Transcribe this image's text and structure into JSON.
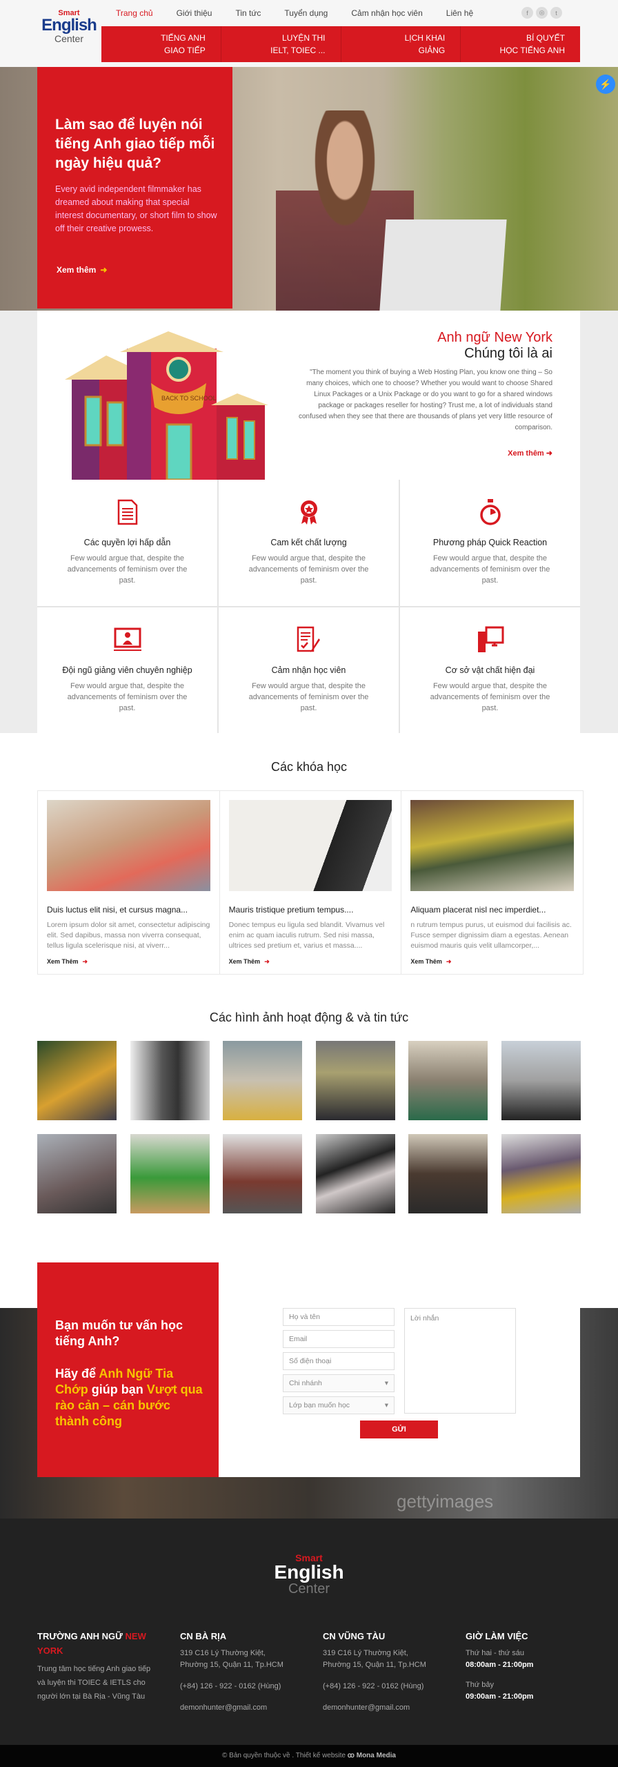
{
  "brand": {
    "logo_smart": "Smart",
    "logo_english": "English",
    "logo_center": "Center"
  },
  "top_nav": [
    {
      "label": "Trang chủ",
      "active": true
    },
    {
      "label": "Giới thiệu"
    },
    {
      "label": "Tin tức"
    },
    {
      "label": "Tuyển dụng"
    },
    {
      "label": "Cảm nhận học viên"
    },
    {
      "label": "Liên hệ"
    }
  ],
  "social": [
    "facebook-icon",
    "instagram-icon",
    "twitter-icon"
  ],
  "main_menu": [
    "Tiếng Anh\nGiao tiếp",
    "Luyện thi\nIELT, TOIEC ...",
    "Lịch khai\ngiảng",
    "Bí quyết\nhọc tiếng Anh"
  ],
  "hero": {
    "title": "Làm sao để luyện nói tiếng Anh giao tiếp mỗi ngày hiệu quả?",
    "body": "Every avid independent filmmaker has dreamed about making that special interest documentary, or short film to show off their creative prowess.",
    "more": "Xem thêm"
  },
  "about": {
    "title_red": "Anh ngữ New York",
    "title": "Chúng tôi là ai",
    "body": "\"The moment you think of buying a Web Hosting Plan, you know one thing – So many choices, which one to choose? Whether you would want to choose Shared Linux Packages or a Unix Package or do you want to go for a shared windows package or packages reseller for hosting? Trust me, a lot of individuals stand confused when they see that there are thousands of plans yet very little resource of comparison.",
    "more": "Xem thêm",
    "banner": "BACK TO SCHOOL"
  },
  "features": [
    {
      "icon": "document-icon",
      "title": "Các quyền lợi hấp dẫn",
      "text": "Few would argue that, despite the advancements of feminism over the past."
    },
    {
      "icon": "award-ribbon-icon",
      "title": "Cam kết chất lượng",
      "text": "Few would argue that, despite the advancements of feminism over the past."
    },
    {
      "icon": "stopwatch-icon",
      "title": "Phương pháp Quick Reaction",
      "text": "Few would argue that, despite the advancements of feminism over the past."
    },
    {
      "icon": "teacher-screen-icon",
      "title": "Đội ngũ giảng viên chuyên nghiệp",
      "text": "Few would argue that, despite the advancements of feminism over the past."
    },
    {
      "icon": "feedback-form-icon",
      "title": "Cảm nhận học viên",
      "text": "Few would argue that, despite the advancements of feminism over the past."
    },
    {
      "icon": "desktop-computer-icon",
      "title": "Cơ sở vật chất hiện đại",
      "text": "Few would argue that, despite the advancements of feminism over the past."
    }
  ],
  "courses": {
    "title": "Các khóa học",
    "items": [
      {
        "title": "Duis luctus elit nisi, et cursus magna...",
        "text": "Lorem ipsum dolor sit amet, consectetur adipiscing elit. Sed dapibus, massa non viverra consequat, tellus ligula scelerisque nisi, at viverr...",
        "more": "Xem Thêm"
      },
      {
        "title": "Mauris tristique pretium tempus....",
        "text": "Donec tempus eu ligula sed blandit. Vivamus vel enim ac quam iaculis rutrum. Sed nisi massa, ultrices sed pretium et, varius et massa....",
        "more": "Xem Thêm"
      },
      {
        "title": "Aliquam placerat nisl nec imperdiet...",
        "text": "n rutrum tempus purus, ut euismod dui facilisis ac. Fusce semper dignissim diam a egestas. Aenean euismod mauris quis velit ullamcorper,...",
        "more": "Xem Thêm"
      }
    ]
  },
  "gallery": {
    "title": "Các hình ảnh hoạt động & và tin tức"
  },
  "contact": {
    "heading1": "Bạn muốn tư vấn học tiếng Anh?",
    "h2_a": "Hãy để ",
    "h2_b": "Anh Ngữ Tia Chớp",
    "h2_c": " giúp bạn ",
    "h2_d": "Vượt qua rào cản – cán bước thành công",
    "name_ph": "Họ và tên",
    "email_ph": "Email",
    "phone_ph": "Số điện thoại",
    "branch": "Chi nhánh",
    "class": "Lớp bạn muốn học",
    "message_ph": "Lời nhắn",
    "submit": "GỬI",
    "watermark": "gettyimages"
  },
  "footer": {
    "col1_title": "TRƯỜNG ANH NGỮ ",
    "col1_title_red": "NEW YORK",
    "col1_text": "Trung tâm học tiếng Anh giao tiếp và luyện thi TOIEC & IETLS cho người lớn tại Bà Rịa - Vũng Tàu",
    "col2_title": "CN BÀ RỊA",
    "col2_addr": "319 C16 Lý Thường Kiệt, Phường 15, Quận 11, Tp.HCM",
    "col2_phone": "(+84) 126 - 922 - 0162 (Hùng)",
    "col2_email": "demonhunter@gmail.com",
    "col3_title": "CN VŨNG TÀU",
    "col3_addr": "319 C16 Lý Thường Kiệt, Phường 15, Quận 11, Tp.HCM",
    "col3_phone": "(+84) 126 - 922 - 0162 (Hùng)",
    "col3_email": "demonhunter@gmail.com",
    "col4_title": "GIỜ LÀM VIỆC",
    "wk_label": "Thứ hai - thứ sáu",
    "wk_hours": "08:00am - 21:00pm",
    "sat_label": "Thứ bảy",
    "sat_hours": "09:00am - 21:00pm",
    "copyright": "© Bản quyền thuộc về . Thiết kế website ",
    "designer": "Mona Media"
  },
  "colors": {
    "brand_red": "#d71920",
    "accent_yellow": "#f7c400",
    "footer_bg": "#222222"
  }
}
